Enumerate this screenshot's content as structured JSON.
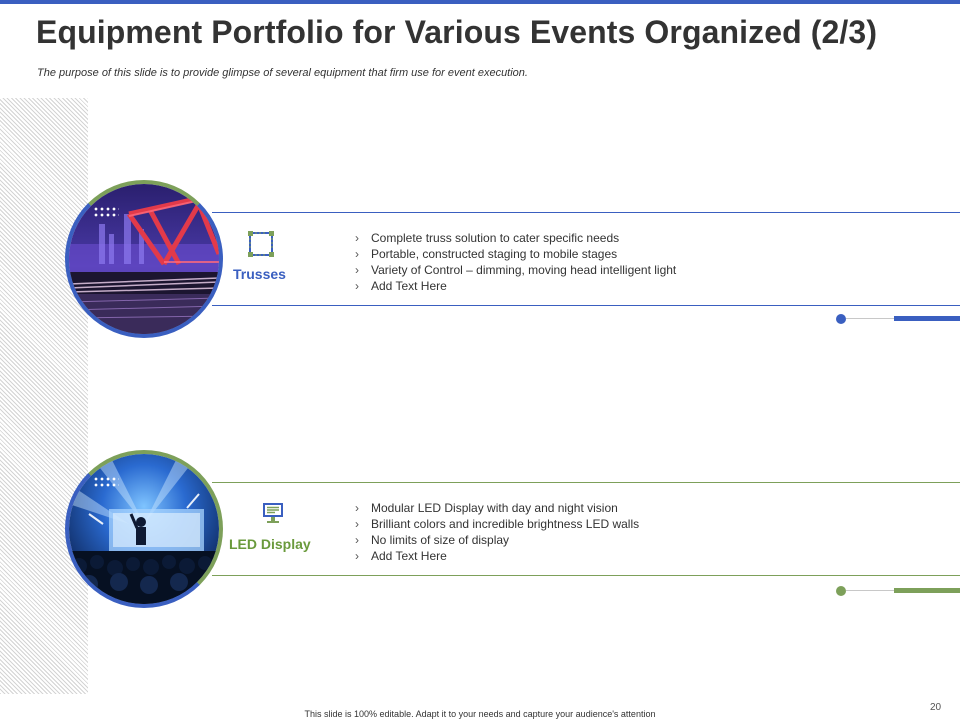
{
  "slide": {
    "title": "Equipment Portfolio for Various Events Organized (2/3)",
    "subtitle": "The purpose of this slide is to provide glimpse of several equipment that firm use for event execution.",
    "footer": "This slide is 100% editable. Adapt it to your needs and capture your audience's attention",
    "page_number": "20"
  },
  "colors": {
    "blue": "#3a5fc0",
    "green": "#7da05a"
  },
  "items": [
    {
      "label": "Trusses",
      "icon": "truss-frame-icon",
      "image": "illuminated-bridge-truss-photo",
      "bullets": [
        "Complete truss solution to cater specific needs",
        "Portable, constructed staging to mobile stages",
        "Variety of Control – dimming, moving head intelligent light",
        "Add Text Here"
      ]
    },
    {
      "label": "LED Display",
      "icon": "monitor-icon",
      "image": "concert-led-screen-photo",
      "bullets": [
        "Modular LED Display with day and night vision",
        "Brilliant colors and incredible brightness LED walls",
        "No limits of size of display",
        "Add Text Here"
      ]
    }
  ]
}
